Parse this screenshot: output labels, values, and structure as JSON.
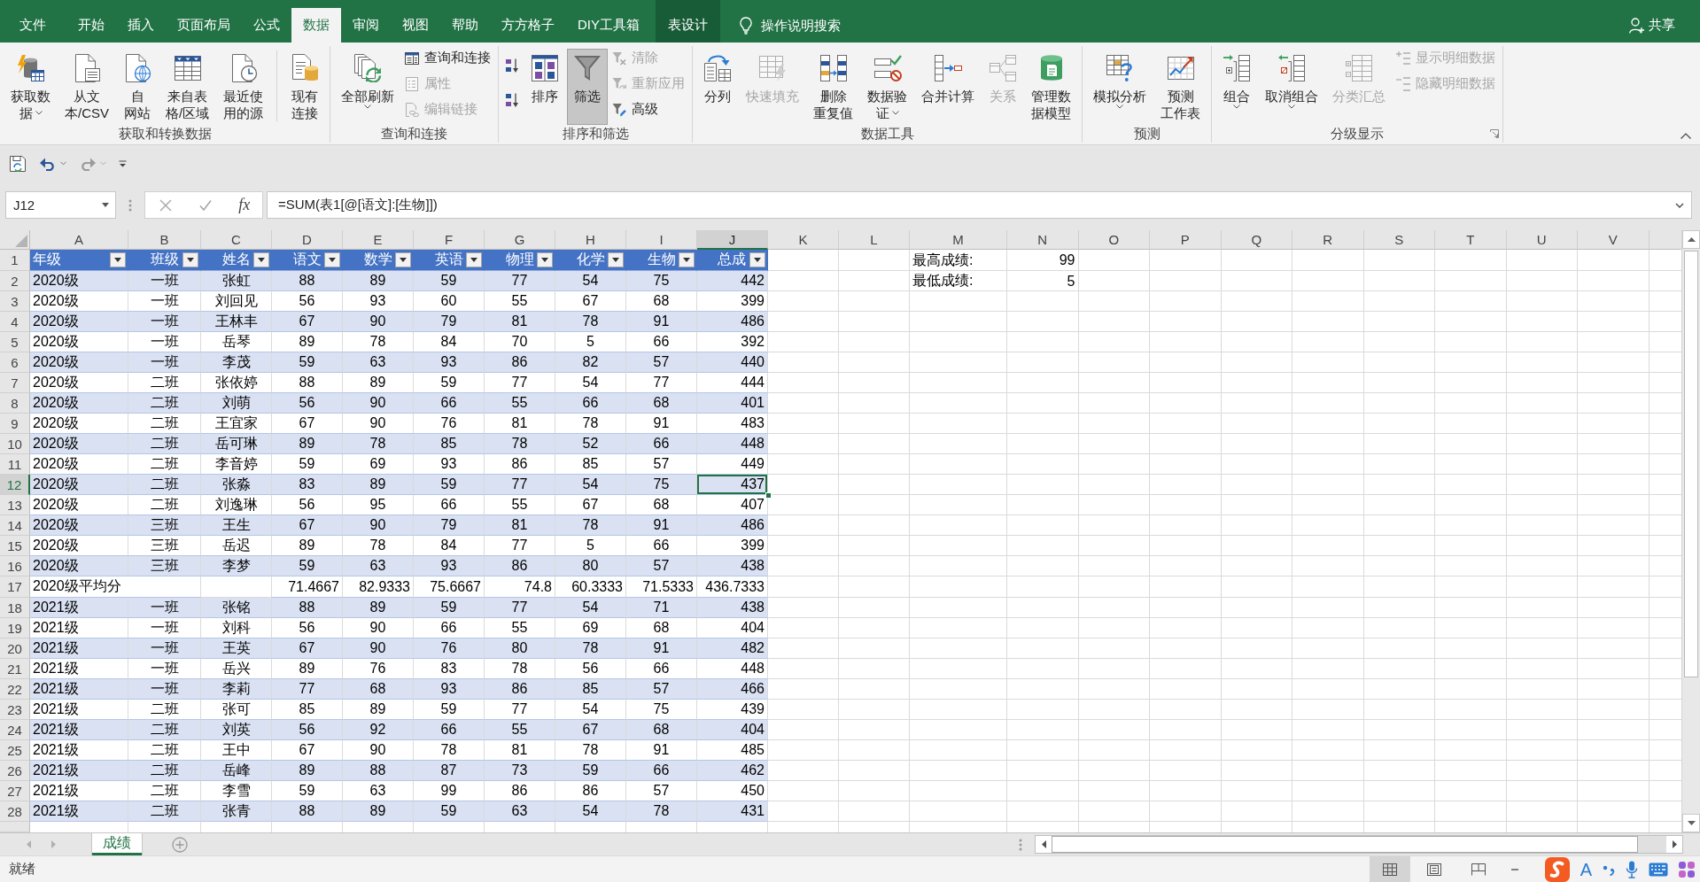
{
  "tab_bar": {
    "tabs": [
      {
        "label": "文件",
        "kind": "tab",
        "selected": false
      },
      {
        "label": "开始",
        "kind": "tab",
        "selected": false
      },
      {
        "label": "插入",
        "kind": "tab",
        "selected": false
      },
      {
        "label": "页面布局",
        "kind": "tab",
        "selected": false
      },
      {
        "label": "公式",
        "kind": "tab",
        "selected": false
      },
      {
        "label": "数据",
        "kind": "tab",
        "selected": true
      },
      {
        "label": "审阅",
        "kind": "tab",
        "selected": false
      },
      {
        "label": "视图",
        "kind": "tab",
        "selected": false
      },
      {
        "label": "帮助",
        "kind": "tab",
        "selected": false
      },
      {
        "label": "方方格子",
        "kind": "tab",
        "selected": false
      },
      {
        "label": "DIY工具箱",
        "kind": "tab",
        "selected": false
      },
      {
        "label": "表设计",
        "kind": "contextual",
        "selected": false
      }
    ],
    "search": {
      "placeholder": "操作说明搜索"
    },
    "share": {
      "label": "共享"
    }
  },
  "ribbon": {
    "groups": [
      {
        "label": "获取和转换数据",
        "launcher": false,
        "items": [
          {
            "kind": "large",
            "lines": [
              "获取数",
              "据"
            ],
            "dropdown": true,
            "disabled": false,
            "on": false
          },
          {
            "kind": "large",
            "lines": [
              "从文",
              "本/CSV"
            ],
            "dropdown": false,
            "disabled": false,
            "on": false
          },
          {
            "kind": "large",
            "lines": [
              "自",
              "网站"
            ],
            "dropdown": false,
            "disabled": false,
            "on": false
          },
          {
            "kind": "large",
            "lines": [
              "来自表",
              "格/区域"
            ],
            "dropdown": false,
            "disabled": false,
            "on": false
          },
          {
            "kind": "large",
            "lines": [
              "最近使",
              "用的源"
            ],
            "dropdown": false,
            "disabled": false,
            "on": false
          },
          {
            "kind": "separator"
          },
          {
            "kind": "large",
            "lines": [
              "现有",
              "连接"
            ],
            "dropdown": false,
            "disabled": false,
            "on": false
          }
        ]
      },
      {
        "label": "查询和连接",
        "launcher": false,
        "items": [
          {
            "kind": "large",
            "lines": [
              "全部刷新"
            ],
            "dropdown": true,
            "disabled": false,
            "on": false
          },
          {
            "kind": "stack",
            "items": [
              {
                "kind": "small",
                "label": "查询和连接",
                "disabled": false
              },
              {
                "kind": "small",
                "label": "属性",
                "disabled": true
              },
              {
                "kind": "small",
                "label": "编辑链接",
                "disabled": true
              }
            ]
          }
        ]
      },
      {
        "label": "排序和筛选",
        "launcher": false,
        "items": [
          {
            "kind": "stack",
            "items": [
              {
                "kind": "icon",
                "disabled": false
              },
              {
                "kind": "icon",
                "disabled": false
              }
            ]
          },
          {
            "kind": "large",
            "lines": [
              "排序"
            ],
            "dropdown": false,
            "disabled": false,
            "on": false
          },
          {
            "kind": "large",
            "lines": [
              "筛选"
            ],
            "dropdown": false,
            "disabled": false,
            "on": true
          },
          {
            "kind": "stack",
            "items": [
              {
                "kind": "small",
                "label": "清除",
                "disabled": true
              },
              {
                "kind": "small",
                "label": "重新应用",
                "disabled": true
              },
              {
                "kind": "small",
                "label": "高级",
                "disabled": false
              }
            ]
          }
        ]
      },
      {
        "label": "数据工具",
        "launcher": false,
        "items": [
          {
            "kind": "large",
            "lines": [
              "分列"
            ],
            "dropdown": false,
            "disabled": false,
            "on": false
          },
          {
            "kind": "large",
            "lines": [
              "快速填充"
            ],
            "dropdown": false,
            "disabled": true,
            "on": false
          },
          {
            "kind": "large",
            "lines": [
              "删除",
              "重复值"
            ],
            "dropdown": false,
            "disabled": false,
            "on": false
          },
          {
            "kind": "large",
            "lines": [
              "数据验",
              "证"
            ],
            "dropdown": true,
            "disabled": false,
            "on": false
          },
          {
            "kind": "large",
            "lines": [
              "合并计算"
            ],
            "dropdown": false,
            "disabled": false,
            "on": false
          },
          {
            "kind": "large",
            "lines": [
              "关系"
            ],
            "dropdown": false,
            "disabled": true,
            "on": false
          },
          {
            "kind": "large",
            "lines": [
              "管理数",
              "据模型"
            ],
            "dropdown": false,
            "disabled": false,
            "on": false
          }
        ]
      },
      {
        "label": "预测",
        "launcher": false,
        "items": [
          {
            "kind": "large",
            "lines": [
              "模拟分析"
            ],
            "dropdown": true,
            "disabled": false,
            "on": false
          },
          {
            "kind": "large",
            "lines": [
              "预测",
              "工作表"
            ],
            "dropdown": false,
            "disabled": false,
            "on": false
          }
        ]
      },
      {
        "label": "分级显示",
        "launcher": true,
        "items": [
          {
            "kind": "large",
            "lines": [
              "组合"
            ],
            "dropdown": true,
            "disabled": false,
            "on": false
          },
          {
            "kind": "large",
            "lines": [
              "取消组合"
            ],
            "dropdown": true,
            "disabled": false,
            "on": false
          },
          {
            "kind": "large",
            "lines": [
              "分类汇总"
            ],
            "dropdown": false,
            "disabled": true,
            "on": false
          },
          {
            "kind": "stack",
            "items": [
              {
                "kind": "small",
                "label": "显示明细数据",
                "disabled": true
              },
              {
                "kind": "small",
                "label": "隐藏明细数据",
                "disabled": true
              }
            ]
          }
        ]
      }
    ]
  },
  "quick_access": [
    {
      "kind": "save",
      "disabled": false,
      "dropdown": false
    },
    {
      "kind": "undo",
      "disabled": false,
      "dropdown": true
    },
    {
      "kind": "redo",
      "disabled": true,
      "dropdown": true
    },
    {
      "kind": "customize",
      "disabled": false,
      "dropdown": false
    }
  ],
  "formula_bar": {
    "name_box": "J12",
    "cancel": {
      "disabled": true
    },
    "enter": {
      "disabled": true
    },
    "function_label": "fx",
    "formula": "=SUM(表1[@[语文]:[生物]])"
  },
  "sheet": {
    "columns": [
      {
        "label": "A",
        "selected": false
      },
      {
        "label": "B",
        "selected": false
      },
      {
        "label": "C",
        "selected": false
      },
      {
        "label": "D",
        "selected": false
      },
      {
        "label": "E",
        "selected": false
      },
      {
        "label": "F",
        "selected": false
      },
      {
        "label": "G",
        "selected": false
      },
      {
        "label": "H",
        "selected": false
      },
      {
        "label": "I",
        "selected": false
      },
      {
        "label": "J",
        "selected": true
      },
      {
        "label": "K",
        "selected": false
      },
      {
        "label": "L",
        "selected": false
      },
      {
        "label": "M",
        "selected": false
      },
      {
        "label": "N",
        "selected": false
      },
      {
        "label": "O",
        "selected": false
      },
      {
        "label": "P",
        "selected": false
      },
      {
        "label": "Q",
        "selected": false
      },
      {
        "label": "R",
        "selected": false
      },
      {
        "label": "S",
        "selected": false
      },
      {
        "label": "T",
        "selected": false
      },
      {
        "label": "U",
        "selected": false
      },
      {
        "label": "V",
        "selected": false
      }
    ],
    "table": {
      "header": {
        "number": "1",
        "selected": false,
        "filter_buttons": true,
        "cells": [
          "年级",
          "班级",
          "姓名",
          "语文",
          "数学",
          "英语",
          "物理",
          "化学",
          "生物",
          "总成"
        ]
      },
      "rows": [
        {
          "number": "2",
          "selected": false,
          "kind": "data",
          "grade": "2020级",
          "class": "一班",
          "name": "张虹",
          "scores": [
            "88",
            "89",
            "59",
            "77",
            "54",
            "75"
          ],
          "total": "442"
        },
        {
          "number": "3",
          "selected": false,
          "kind": "data",
          "grade": "2020级",
          "class": "一班",
          "name": "刘回见",
          "scores": [
            "56",
            "93",
            "60",
            "55",
            "67",
            "68"
          ],
          "total": "399"
        },
        {
          "number": "4",
          "selected": false,
          "kind": "data",
          "grade": "2020级",
          "class": "一班",
          "name": "王林丰",
          "scores": [
            "67",
            "90",
            "79",
            "81",
            "78",
            "91"
          ],
          "total": "486"
        },
        {
          "number": "5",
          "selected": false,
          "kind": "data",
          "grade": "2020级",
          "class": "一班",
          "name": "岳琴",
          "scores": [
            "89",
            "78",
            "84",
            "70",
            "5",
            "66"
          ],
          "total": "392"
        },
        {
          "number": "6",
          "selected": false,
          "kind": "data",
          "grade": "2020级",
          "class": "一班",
          "name": "李茂",
          "scores": [
            "59",
            "63",
            "93",
            "86",
            "82",
            "57"
          ],
          "total": "440"
        },
        {
          "number": "7",
          "selected": false,
          "kind": "data",
          "grade": "2020级",
          "class": "二班",
          "name": "张依婷",
          "scores": [
            "88",
            "89",
            "59",
            "77",
            "54",
            "77"
          ],
          "total": "444"
        },
        {
          "number": "8",
          "selected": false,
          "kind": "data",
          "grade": "2020级",
          "class": "二班",
          "name": "刘萌",
          "scores": [
            "56",
            "90",
            "66",
            "55",
            "66",
            "68"
          ],
          "total": "401"
        },
        {
          "number": "9",
          "selected": false,
          "kind": "data",
          "grade": "2020级",
          "class": "二班",
          "name": "王宜家",
          "scores": [
            "67",
            "90",
            "76",
            "81",
            "78",
            "91"
          ],
          "total": "483"
        },
        {
          "number": "10",
          "selected": false,
          "kind": "data",
          "grade": "2020级",
          "class": "二班",
          "name": "岳可琳",
          "scores": [
            "89",
            "78",
            "85",
            "78",
            "52",
            "66"
          ],
          "total": "448"
        },
        {
          "number": "11",
          "selected": false,
          "kind": "data",
          "grade": "2020级",
          "class": "二班",
          "name": "李音婷",
          "scores": [
            "59",
            "69",
            "93",
            "86",
            "85",
            "57"
          ],
          "total": "449"
        },
        {
          "number": "12",
          "selected": true,
          "kind": "data",
          "grade": "2020级",
          "class": "二班",
          "name": "张淼",
          "scores": [
            "83",
            "89",
            "59",
            "77",
            "54",
            "75"
          ],
          "total": "437"
        },
        {
          "number": "13",
          "selected": false,
          "kind": "data",
          "grade": "2020级",
          "class": "二班",
          "name": "刘逸琳",
          "scores": [
            "56",
            "95",
            "66",
            "55",
            "67",
            "68"
          ],
          "total": "407"
        },
        {
          "number": "14",
          "selected": false,
          "kind": "data",
          "grade": "2020级",
          "class": "三班",
          "name": "王生",
          "scores": [
            "67",
            "90",
            "79",
            "81",
            "78",
            "91"
          ],
          "total": "486"
        },
        {
          "number": "15",
          "selected": false,
          "kind": "data",
          "grade": "2020级",
          "class": "三班",
          "name": "岳迟",
          "scores": [
            "89",
            "78",
            "84",
            "77",
            "5",
            "66"
          ],
          "total": "399"
        },
        {
          "number": "16",
          "selected": false,
          "kind": "data",
          "grade": "2020级",
          "class": "三班",
          "name": "李梦",
          "scores": [
            "59",
            "63",
            "93",
            "86",
            "80",
            "57"
          ],
          "total": "438"
        },
        {
          "number": "17",
          "selected": false,
          "kind": "average",
          "label": "2020级平均分",
          "scores": [
            "71.4667",
            "82.9333",
            "75.6667",
            "74.8",
            "60.3333",
            "71.5333"
          ],
          "total": "436.7333"
        },
        {
          "number": "18",
          "selected": false,
          "kind": "data",
          "grade": "2021级",
          "class": "一班",
          "name": "张铭",
          "scores": [
            "88",
            "89",
            "59",
            "77",
            "54",
            "71"
          ],
          "total": "438"
        },
        {
          "number": "19",
          "selected": false,
          "kind": "data",
          "grade": "2021级",
          "class": "一班",
          "name": "刘科",
          "scores": [
            "56",
            "90",
            "66",
            "55",
            "69",
            "68"
          ],
          "total": "404"
        },
        {
          "number": "20",
          "selected": false,
          "kind": "data",
          "grade": "2021级",
          "class": "一班",
          "name": "王英",
          "scores": [
            "67",
            "90",
            "76",
            "80",
            "78",
            "91"
          ],
          "total": "482"
        },
        {
          "number": "21",
          "selected": false,
          "kind": "data",
          "grade": "2021级",
          "class": "一班",
          "name": "岳兴",
          "scores": [
            "89",
            "76",
            "83",
            "78",
            "56",
            "66"
          ],
          "total": "448"
        },
        {
          "number": "22",
          "selected": false,
          "kind": "data",
          "grade": "2021级",
          "class": "一班",
          "name": "李莉",
          "scores": [
            "77",
            "68",
            "93",
            "86",
            "85",
            "57"
          ],
          "total": "466"
        },
        {
          "number": "23",
          "selected": false,
          "kind": "data",
          "grade": "2021级",
          "class": "二班",
          "name": "张可",
          "scores": [
            "85",
            "89",
            "59",
            "77",
            "54",
            "75"
          ],
          "total": "439"
        },
        {
          "number": "24",
          "selected": false,
          "kind": "data",
          "grade": "2021级",
          "class": "二班",
          "name": "刘英",
          "scores": [
            "56",
            "92",
            "66",
            "55",
            "67",
            "68"
          ],
          "total": "404"
        },
        {
          "number": "25",
          "selected": false,
          "kind": "data",
          "grade": "2021级",
          "class": "二班",
          "name": "王中",
          "scores": [
            "67",
            "90",
            "78",
            "81",
            "78",
            "91"
          ],
          "total": "485"
        },
        {
          "number": "26",
          "selected": false,
          "kind": "data",
          "grade": "2021级",
          "class": "二班",
          "name": "岳峰",
          "scores": [
            "89",
            "88",
            "87",
            "73",
            "59",
            "66"
          ],
          "total": "462"
        },
        {
          "number": "27",
          "selected": false,
          "kind": "data",
          "grade": "2021级",
          "class": "二班",
          "name": "李雪",
          "scores": [
            "59",
            "63",
            "99",
            "86",
            "86",
            "57"
          ],
          "total": "450"
        },
        {
          "number": "28",
          "selected": false,
          "kind": "data",
          "grade": "2021级",
          "class": "二班",
          "name": "张青",
          "scores": [
            "88",
            "89",
            "59",
            "63",
            "54",
            "78"
          ],
          "total": "431"
        }
      ]
    },
    "summary": [
      {
        "label": "最高成绩:",
        "value": "99"
      },
      {
        "label": "最低成绩:",
        "value": "5"
      }
    ],
    "tabs": [
      {
        "label": "成绩",
        "selected": true
      }
    ]
  },
  "status_bar": {
    "text": "就绪",
    "views": [
      {
        "kind": "normal",
        "selected": true
      },
      {
        "kind": "page-layout",
        "selected": false
      },
      {
        "kind": "page-break",
        "selected": false
      }
    ]
  },
  "ime_toolbar": {
    "mode": "A"
  }
}
